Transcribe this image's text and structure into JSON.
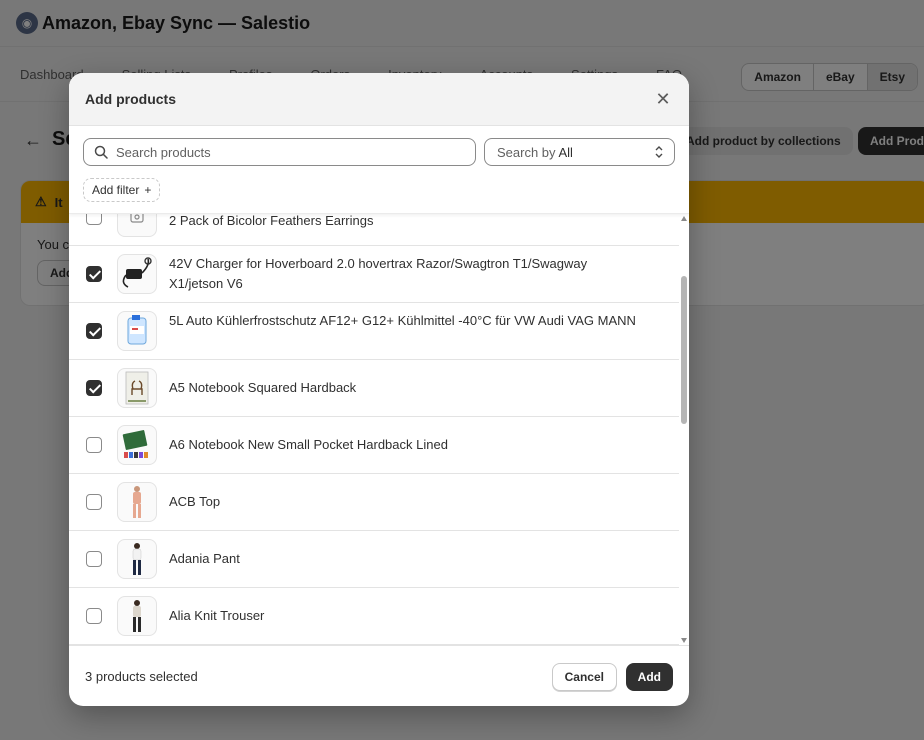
{
  "app": {
    "title": "Amazon, Ebay Sync — Salestio"
  },
  "nav": {
    "tabs": [
      "Dashboard",
      "Selling Lists",
      "Profiles",
      "Orders",
      "Inventory",
      "Accounts",
      "Settings",
      "FAQ"
    ],
    "channels": [
      "Amazon",
      "eBay",
      "Etsy"
    ],
    "active_channel": "Etsy"
  },
  "page": {
    "title": "Se",
    "collections_button": "Add product by collections",
    "add_products_button": "Add Prod",
    "banner_title": "It",
    "banner_text": "You c",
    "banner_button": "Add"
  },
  "modal": {
    "title": "Add products",
    "search": {
      "placeholder": "Search products",
      "value": ""
    },
    "search_by": {
      "prefix": "Search by",
      "value": "All"
    },
    "add_filter_label": "Add filter",
    "products": [
      {
        "name": "2 Pack of Bicolor Feathers Earrings",
        "checked": false,
        "thumb": "placeholder-icon"
      },
      {
        "name": "42V Charger for Hoverboard 2.0 hovertrax Razor/Swagtron T1/Swagway X1/jetson V6",
        "checked": true,
        "thumb": "charger"
      },
      {
        "name": "5L Auto Kühlerfrostschutz AF12+ G12+ Kühlmittel -40°C für VW Audi VAG MANN",
        "checked": true,
        "thumb": "coolant"
      },
      {
        "name": "A5 Notebook Squared Hardback",
        "checked": true,
        "thumb": "notebook-deer"
      },
      {
        "name": "A6 Notebook New Small Pocket Hardback Lined",
        "checked": false,
        "thumb": "notebook-green"
      },
      {
        "name": "ACB Top",
        "checked": false,
        "thumb": "apparel"
      },
      {
        "name": "Adania Pant",
        "checked": false,
        "thumb": "apparel"
      },
      {
        "name": "Alia Knit Trouser",
        "checked": false,
        "thumb": "apparel"
      }
    ],
    "footer": {
      "selected_text": "3 products selected",
      "cancel_label": "Cancel",
      "add_label": "Add"
    }
  }
}
